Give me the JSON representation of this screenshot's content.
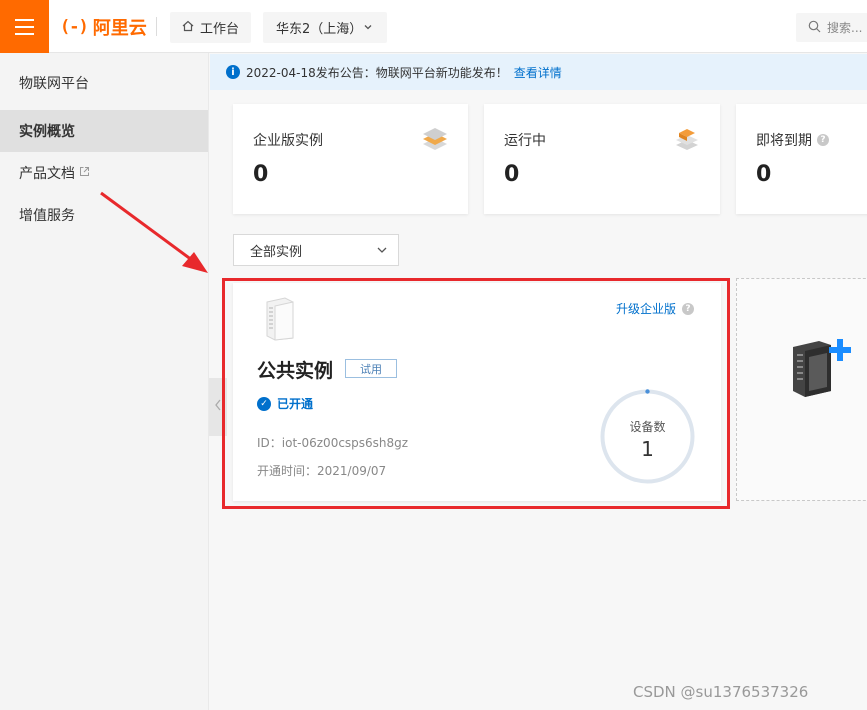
{
  "topbar": {
    "logo_mark": "(-)",
    "logo_text": "阿里云",
    "workspace_label": "工作台",
    "region_label": "华东2（上海）",
    "search_placeholder": "搜索..."
  },
  "sidebar": {
    "title": "物联网平台",
    "items": [
      {
        "label": "实例概览",
        "active": true
      },
      {
        "label": "产品文档"
      },
      {
        "label": "增值服务"
      }
    ]
  },
  "notice": {
    "text": "2022-04-18发布公告：物联网平台新功能发布！",
    "link": "查看详情"
  },
  "stats": [
    {
      "label": "企业版实例",
      "value": "0"
    },
    {
      "label": "运行中",
      "value": "0"
    },
    {
      "label": "即将到期",
      "value": "0"
    }
  ],
  "filter": {
    "selected": "全部实例"
  },
  "instance_card": {
    "upgrade_label": "升级企业版",
    "name": "公共实例",
    "badge": "试用",
    "status": "已开通",
    "id_text": "ID：iot-06z00csps6sh8gz",
    "open_time": "开通时间：2021/09/07",
    "device_label": "设备数",
    "device_count": "1"
  },
  "watermark": "CSDN @su1376537326",
  "colors": {
    "brand": "#ff6a00",
    "link": "#0070cc",
    "highlight": "#e8292c"
  }
}
